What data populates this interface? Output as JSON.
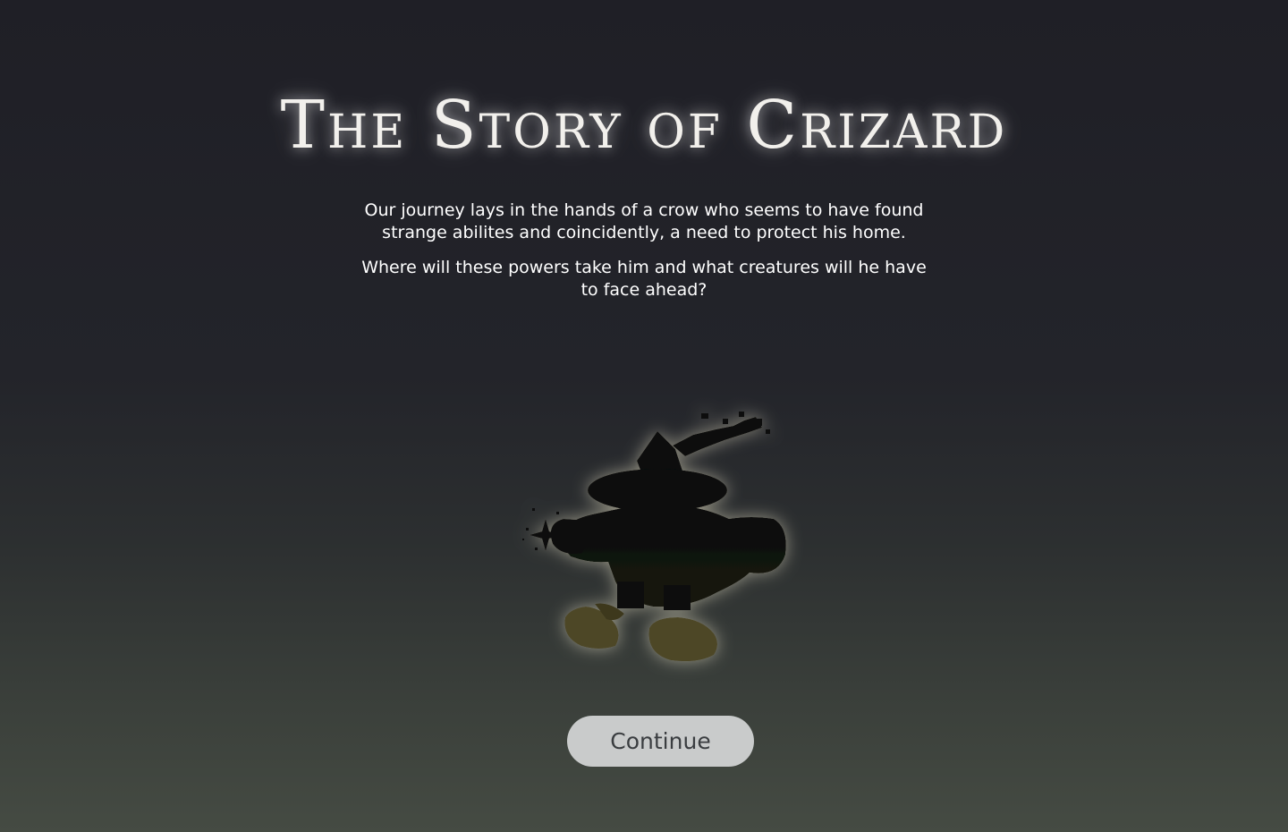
{
  "title": "The Story of Crizard",
  "intro": {
    "paragraph_1": "Our journey lays in the hands of a crow who seems to have found strange abilites and coincidently, a need to protect his home.",
    "paragraph_2": "Where will these powers take him and what creatures will he have to face ahead?"
  },
  "character": {
    "icon": "crow-wizard-silhouette-icon"
  },
  "continue_button": {
    "label": "Continue"
  },
  "colors": {
    "background_top": "#1f1f26",
    "background_bottom": "#454b43",
    "button_bg": "#c9cbcb",
    "button_text": "#3a3d40",
    "title_glow": "#ffffff",
    "feet_color": "#4d4626"
  }
}
